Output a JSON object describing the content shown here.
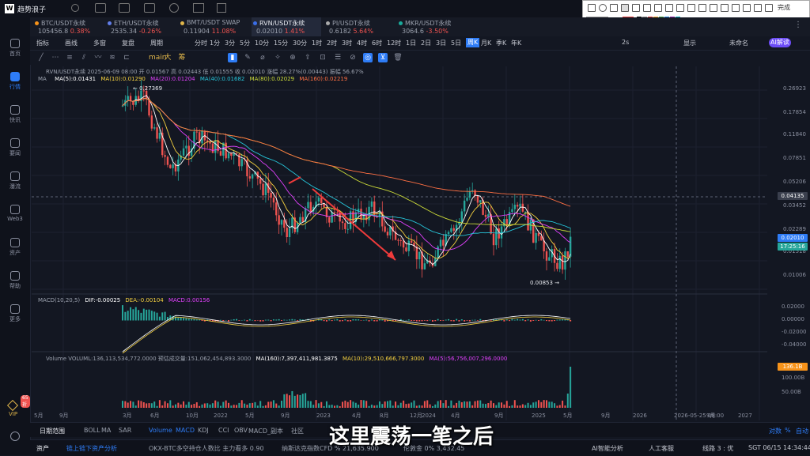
{
  "app": {
    "title": "趋势浪子"
  },
  "window_controls": {
    "minimize": "—",
    "maximize": "□",
    "close": "✕"
  },
  "sidebar": {
    "items": [
      {
        "label": "首页",
        "icon": "home-icon"
      },
      {
        "label": "行情",
        "icon": "chart-icon"
      },
      {
        "label": "快讯",
        "icon": "news-icon"
      },
      {
        "label": "要闻",
        "icon": "bulletin-icon"
      },
      {
        "label": "瀑流",
        "icon": "stream-icon"
      },
      {
        "label": "Web3",
        "icon": "web3-icon"
      },
      {
        "label": "资产",
        "icon": "wallet-icon"
      },
      {
        "label": "帮助",
        "icon": "help-icon"
      },
      {
        "label": "更多",
        "icon": "more-icon"
      }
    ],
    "vip_badge": "65折",
    "vip_label": "VIP",
    "settings_icon": "gear-icon"
  },
  "tabs": [
    {
      "name": "BTC/USDT永续",
      "price": "105456.8",
      "change": "0.38%",
      "color": "#ef5350",
      "dot": "#f7931a"
    },
    {
      "name": "ETH/USDT永续",
      "price": "2535.34",
      "change": "-0.26%",
      "color": "#ef5350",
      "dot": "#627eea"
    },
    {
      "name": "BMT/USDT SWAP",
      "price": "0.11904",
      "change": "11.08%",
      "color": "#ef5350",
      "dot": "#e0b64a"
    },
    {
      "name": "RVN/USDT永续",
      "price": "0.02010",
      "change": "1.41%",
      "color": "#ef5350",
      "dot": "#3a6ee8",
      "active": true
    },
    {
      "name": "PI/USDT永续",
      "price": "0.6182",
      "change": "5.64%",
      "color": "#ef5350",
      "dot": "#aaaaaa"
    },
    {
      "name": "MKR/USDT永续",
      "price": "3064.6",
      "change": "-3.50%",
      "color": "#ef5350",
      "dot": "#1aab9b"
    }
  ],
  "toolbar": {
    "left": [
      "指标",
      "画线",
      "多窗",
      "复盘",
      "周期"
    ],
    "periods": [
      "分时",
      "1分",
      "3分",
      "5分",
      "10分",
      "15分",
      "30分",
      "1时",
      "2时",
      "3时",
      "4时",
      "6时",
      "12时",
      "1日",
      "2日",
      "3日",
      "5日",
      "周K",
      "月K",
      "季K",
      "年K"
    ],
    "active_period": "周K",
    "right": [
      "2s",
      "显示",
      "未命名",
      "AI解读"
    ]
  },
  "draw_tools": [
    "main",
    "大",
    "筹"
  ],
  "legend": {
    "symbol_line": "RVN/USDT永续  2025-06-09 08:00  开 0.01567  高 0.02443  低 0.01555  收 0.02010  涨幅 28.27%(0.00443)  振幅 56.67%",
    "ma_label": "MA",
    "ma5": "MA(5):0.01431",
    "ma10": "MA(10):0.01290",
    "ma20": "MA(20):0.01204",
    "ma40": "MA(40):0.01682",
    "ma80": "MA(80):0.02029",
    "ma160": "MA(160):0.02219",
    "macd_label": "MACD(10,20,5)",
    "dif": "DIF:-0.00025",
    "dea": "DEA:-0.00104",
    "macd": "MACD:0.00156",
    "vol_label": "Volume  VOLUML:136,113,534,772.0000  预估成交量:151,062,454,893.3000",
    "vol_ma160": "MA(160):7,397,411,981.3875",
    "vol_ma10": "MA(10):29,510,666,797.3000",
    "vol_ma5": "MA(5):56,756,007,296.0000"
  },
  "annotations": {
    "high": "0.27369",
    "low": "0.00853"
  },
  "price_axis": [
    "0.26923",
    "0.17854",
    "0.11840",
    "0.07851",
    "0.05206",
    "0.03452",
    "0.02289",
    "0.01518",
    "0.01006"
  ],
  "macd_axis": [
    "0.02000",
    "0.00000",
    "-0.02000",
    "-0.04000"
  ],
  "vol_axis": [
    "100.00B",
    "50.00B"
  ],
  "crosshair_price": "0.04135",
  "last_price": "0.02010",
  "countdown": "17:25:16",
  "vol_last": "136.1B",
  "time_axis": [
    "3月",
    "6月",
    "10月",
    "2022",
    "5月",
    "9月",
    "2023",
    "4月",
    "8月",
    "12月",
    "2024",
    "4月",
    "9月",
    "2025",
    "5月",
    "9月",
    "2026",
    "2026-05-25 08:00",
    "9月",
    "2027",
    "5月",
    "9月"
  ],
  "bottom_tabs": {
    "range_label": "日期范围",
    "main": [
      "BOLL",
      "MA",
      "SAR"
    ],
    "sub": [
      "Volume",
      "MACD",
      "KDJ",
      "CCI",
      "OBV",
      "MACD_副本"
    ],
    "right": [
      "对数",
      "%",
      "自动"
    ],
    "community": "社区"
  },
  "status": {
    "asset_label": "资产",
    "chain": "链上链下资产分析",
    "ticker": "OKX-BTC多空持仓人数比  主力看多  0.90",
    "ticker2": "纳斯达克指数CFD  %  21,635.900",
    "ticker3": "伦敦金  0%  3,432.45",
    "ai": "AI智能分析",
    "service": "人工客服",
    "line": "线路 3 : 优",
    "time": "SGT 06/15 14:34:44"
  },
  "subtitle": "这里震荡一笔之后",
  "draw_panel": {
    "done": "完成"
  },
  "chart_data": {
    "type": "candlestick",
    "series": [
      {
        "name": "RVN/USDT永续"
      }
    ]
  }
}
